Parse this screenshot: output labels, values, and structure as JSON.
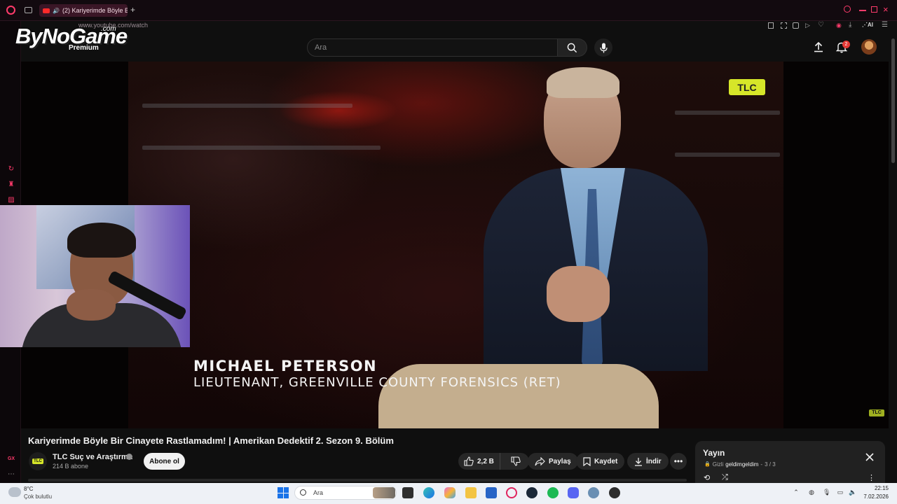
{
  "browser": {
    "tab_title": "(2) Kariyerimde Böyle B",
    "url": "www.youtube.com/watch"
  },
  "overlay_logo": {
    "brand": "ByNoGame",
    "dotcom": ".com",
    "premium": "Premium"
  },
  "youtube": {
    "search_placeholder": "Ara",
    "notification_count": "2"
  },
  "video": {
    "channel_badge": "TLC",
    "channel_badge_small": "TLC",
    "lower_third_name": "MICHAEL PETERSON",
    "lower_third_title": "LIEUTENANT, GREENVILLE COUNTY FORENSICS (RET)"
  },
  "watch": {
    "title": "Kariyerimde Böyle Bir Cinayete Rastlamadım! | Amerikan Dedektif 2. Sezon 9. Bölüm",
    "channel_avatar_text": "TLC",
    "channel_name": "TLC Suç ve Araştırma",
    "subscribers": "214 B abone",
    "subscribe_label": "Abone ol",
    "like_count": "2,2 B",
    "share_label": "Paylaş",
    "save_label": "Kaydet",
    "download_label": "İndir"
  },
  "playlist_panel": {
    "title": "Yayın",
    "privacy": "Gizli",
    "owner": "geldimgeldim",
    "position": "3 / 3"
  },
  "taskbar": {
    "temperature": "8°C",
    "condition": "Çok bulutlu",
    "search_placeholder": "Ara",
    "time": "22:15",
    "date": "7.02.2026"
  },
  "colors": {
    "youtube_bg": "#0f0f0f",
    "browser_accent": "#ff3b6b",
    "tlc_yellow": "#d6e629"
  }
}
